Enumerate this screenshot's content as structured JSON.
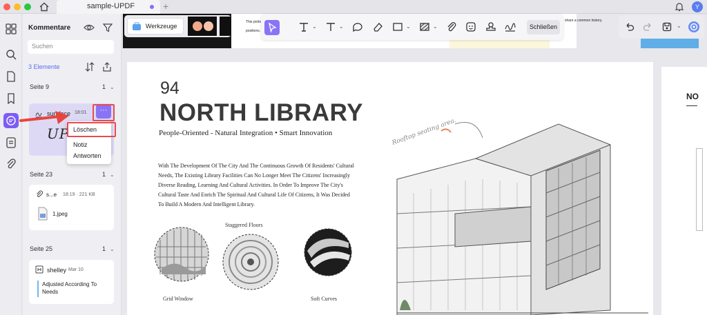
{
  "app": {
    "tab_title": "sample-UPDF",
    "new_tab": "+",
    "avatar_initial": "Y",
    "accent_color": "#7c5cf5"
  },
  "toolbar": {
    "tools_label": "Werkzeuge",
    "close_label": "Schließen",
    "tools": [
      "cursor-icon",
      "text-t-icon",
      "text-box-icon",
      "comment-icon",
      "eraser-icon",
      "rectangle-icon",
      "area-highlight-icon",
      "attachment-icon",
      "sticker-icon",
      "stamp-icon",
      "signature-icon"
    ],
    "right_tools": [
      "undo-icon",
      "redo-icon",
      "save-icon",
      "ai-assistant-icon"
    ]
  },
  "sidebar": {
    "title": "Kommentare",
    "search_placeholder": "Suchen",
    "count": "3 Elemente",
    "sections": [
      {
        "label": "Seite 9",
        "count": "1",
        "comment": {
          "author": "sun.face",
          "time": "18:01",
          "preview": "UP"
        }
      },
      {
        "label": "Seite 23",
        "count": "1",
        "comment": {
          "author": "s...e",
          "meta": "18:19 · 221 KB",
          "file": "1.jpeg"
        }
      },
      {
        "label": "Seite 25",
        "count": "1",
        "comment": {
          "author": "shelley",
          "date": "Mar 10",
          "text": "Adjusted According To Needs"
        }
      }
    ],
    "more_label": "···"
  },
  "context_menu": {
    "items": [
      "Löschen",
      "Notiz",
      "Antworten"
    ],
    "highlight_color": "#e84b4b"
  },
  "document": {
    "strip_text_1": "This proba",
    "strip_text_2": "positions.",
    "strip_text_3": "share a common history.",
    "page_number": "94",
    "title": "NORTH LIBRARY",
    "subtitle": "People-Oriented - Natural Integration • Smart Innovation",
    "body": "With The Development Of The City And The Continuous Growth Of Residents' Cultural Needs, The Existing Library Facilities Can No Longer Meet The Citizens' Increasingly Diverse Reading, Learning And Cultural Activities. In Order To Improve The City's Cultural Taste And Enrich The Spiritual And Cultural Life Of Citizens, It Was Decided To Build A Modern And Intelligent Library.",
    "labels": {
      "staggered": "Staggered Floors",
      "grid": "Grid Window",
      "soft": "Soft Curves",
      "rooftop": "Rooftop seating area."
    },
    "next_page_title": "NO"
  }
}
